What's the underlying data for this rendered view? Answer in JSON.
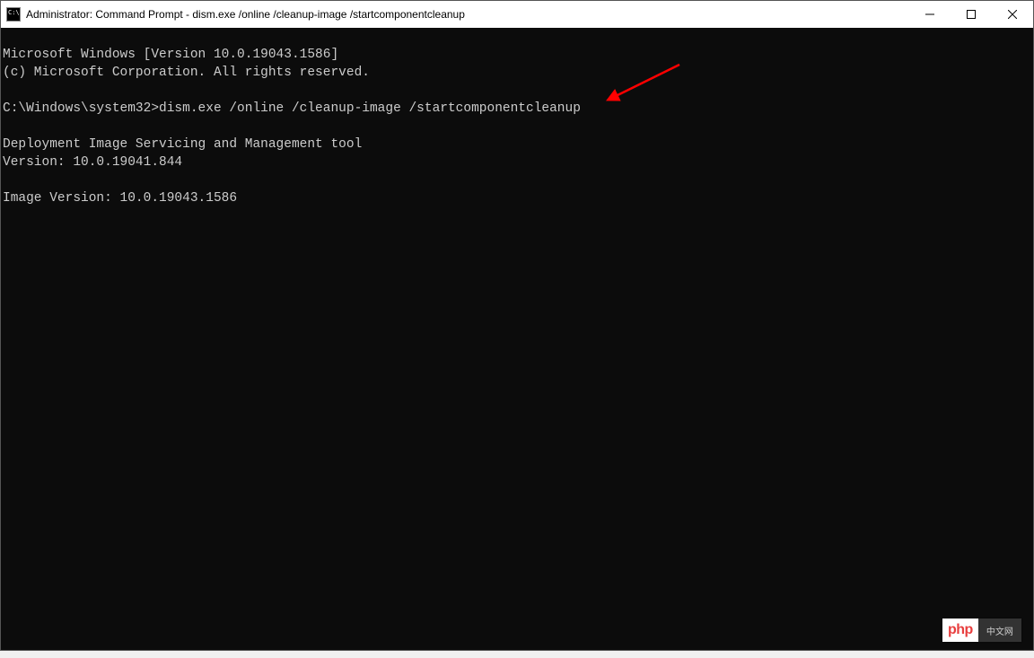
{
  "window": {
    "title": "Administrator: Command Prompt - dism.exe  /online /cleanup-image /startcomponentcleanup"
  },
  "terminal": {
    "line1": "Microsoft Windows [Version 10.0.19043.1586]",
    "line2": "(c) Microsoft Corporation. All rights reserved.",
    "blank1": "",
    "promptLine": "C:\\Windows\\system32>dism.exe /online /cleanup-image /startcomponentcleanup",
    "blank2": "",
    "toolName": "Deployment Image Servicing and Management tool",
    "toolVersion": "Version: 10.0.19041.844",
    "blank3": "",
    "imageVersion": "Image Version: 10.0.19043.1586"
  },
  "watermark": {
    "left": "php",
    "right": "中文网"
  }
}
